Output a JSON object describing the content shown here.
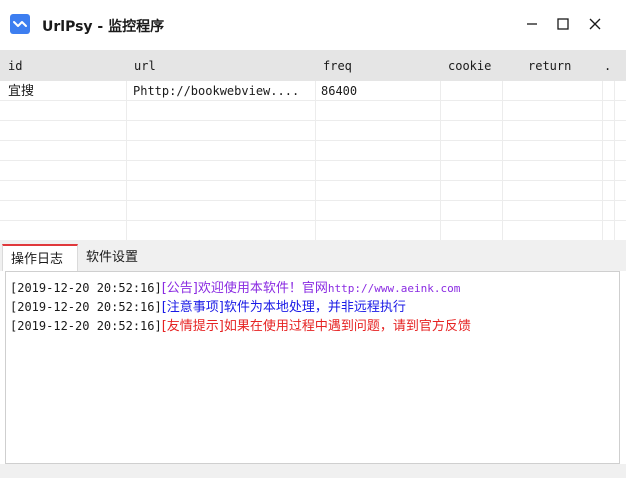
{
  "window": {
    "title": "UrlPsy - 监控程序"
  },
  "table": {
    "columns": [
      "id",
      "url",
      "freq",
      "cookie",
      "return",
      "."
    ],
    "rows": [
      {
        "id": "宜搜",
        "url": "Phttp://bookwebview....",
        "freq": "86400"
      }
    ]
  },
  "tabs": [
    {
      "label": "操作日志",
      "active": true
    },
    {
      "label": "软件设置",
      "active": false
    }
  ],
  "log": [
    {
      "time": "[2019-12-20 20:52:16]",
      "message": "[公告]欢迎使用本软件！官网",
      "url": "http://www.aeink.com",
      "color": "#8a2be2"
    },
    {
      "time": "[2019-12-20 20:52:16]",
      "message": "[注意事项]软件为本地处理，并非远程执行",
      "color": "#1a1ae6"
    },
    {
      "time": "[2019-12-20 20:52:16]",
      "message": "[友情提示]如果在使用过程中遇到问题，请到官方反馈",
      "color": "#e62222"
    }
  ],
  "colors": {
    "accent": "#e0383b",
    "app_icon": "#3d7ef0",
    "header_bg": "#e5e5e5"
  },
  "icons": [
    "app-logo-icon",
    "minimize-icon",
    "maximize-icon",
    "close-icon"
  ]
}
